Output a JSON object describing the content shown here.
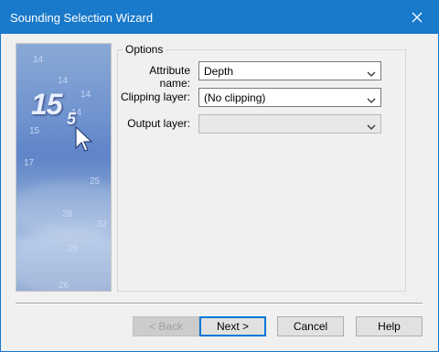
{
  "window": {
    "title": "Sounding Selection Wizard"
  },
  "art": {
    "soundings": [
      "14",
      "14",
      "14",
      "14",
      "15",
      "17",
      "25",
      "28",
      "32",
      "29",
      "26"
    ],
    "main_value": "15",
    "main_subscript": "5"
  },
  "options": {
    "group_label": "Options",
    "attribute": {
      "label": "Attribute name:",
      "value": "Depth"
    },
    "clipping": {
      "label": "Clipping layer:",
      "value": "(No clipping)"
    },
    "output": {
      "label": "Output layer:",
      "value": ""
    }
  },
  "buttons": {
    "back": "< Back",
    "next": "Next >",
    "cancel": "Cancel",
    "help": "Help"
  },
  "colors": {
    "title_bar": "#1979ca",
    "dialog_bg": "#f0f0f0",
    "default_button_border": "#0078d7"
  }
}
